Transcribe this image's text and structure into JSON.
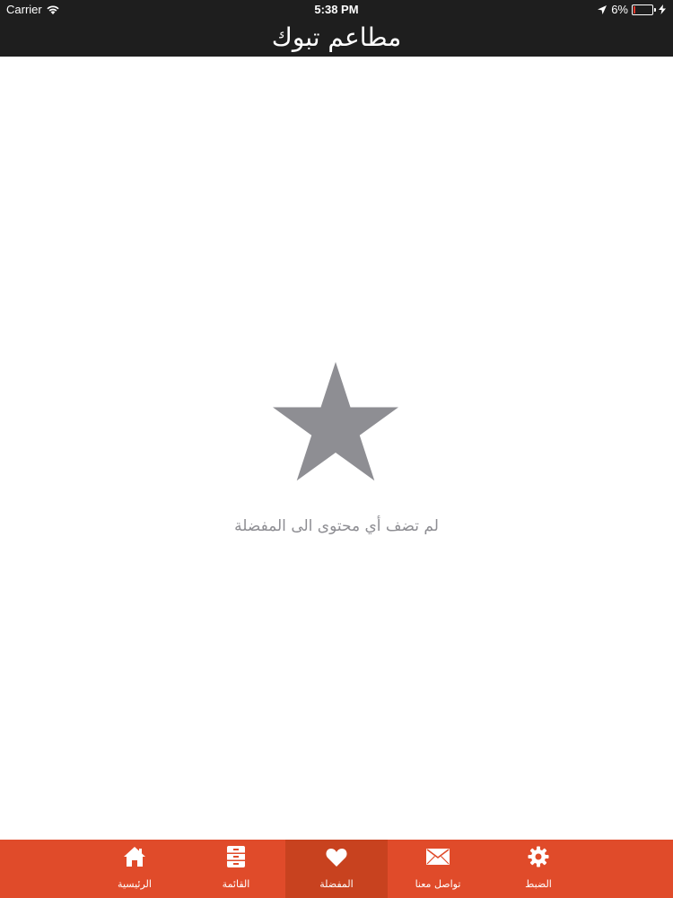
{
  "status_bar": {
    "carrier": "Carrier",
    "time": "5:38 PM",
    "battery": "6%",
    "battery_level": 0.06
  },
  "nav": {
    "title": "مطاعم تبوك"
  },
  "empty_state": {
    "icon": "star-icon",
    "message": "لم تضف أي محتوى الى المفضلة"
  },
  "tabs": [
    {
      "label": "الرئيسية",
      "icon": "home-icon"
    },
    {
      "label": "القائمة",
      "icon": "cabinet-icon"
    },
    {
      "label": "المفضلة",
      "icon": "heart-icon",
      "active": true
    },
    {
      "label": "تواصل معنا",
      "icon": "envelope-icon"
    },
    {
      "label": "الضبط",
      "icon": "gear-icon"
    }
  ],
  "colors": {
    "bar_background": "#1e1e1e",
    "tab_bar": "#e04b2a",
    "tab_active": "#c8421f",
    "star": "#8e8e93"
  }
}
